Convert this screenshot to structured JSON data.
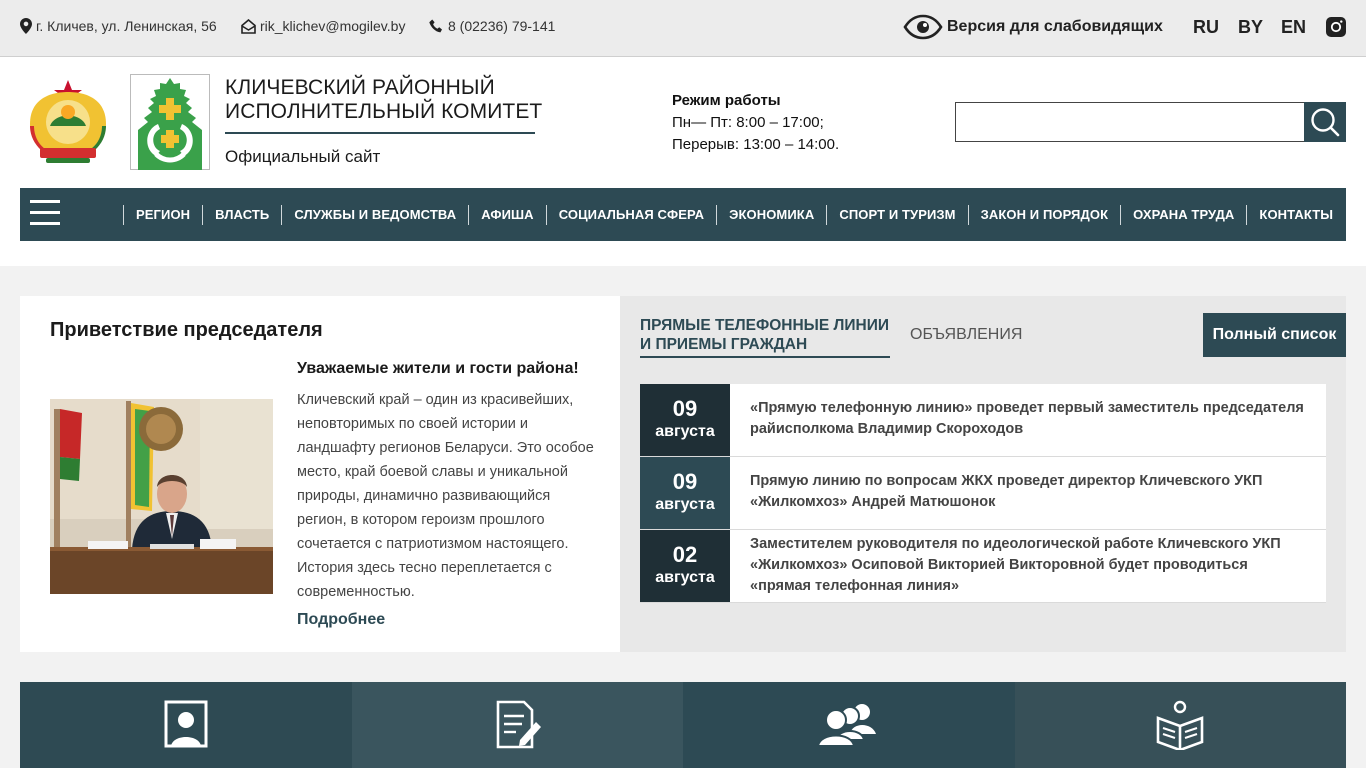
{
  "topbar": {
    "address": "г. Кличев, ул. Ленинская, 56",
    "email": "rik_klichev@mogilev.by",
    "phone": "8 (02236) 79-141",
    "accessibility": "Версия для слабовидящих",
    "languages": [
      "RU",
      "BY",
      "EN"
    ]
  },
  "header": {
    "title_line1": "Кличевский районный",
    "title_line2": "исполнительный комитет",
    "subtitle": "Официальный сайт",
    "hours_title": "Режим работы",
    "hours_line1": "Пн— Пт: 8:00 – 17:00;",
    "hours_line2": "Перерыв: 13:00 – 14:00.",
    "search_value": ""
  },
  "nav": {
    "items": [
      "Регион",
      "Власть",
      "Службы и ведомства",
      "Афиша",
      "Социальная сфера",
      "Экономика",
      "Спорт и туризм",
      "Закон и порядок",
      "Охрана труда",
      "Контакты"
    ]
  },
  "greeting": {
    "title": "Приветствие председателя",
    "heading": "Уважаемые жители и гости района!",
    "text": "Кличевский край – один из красивейших, неповторимых по своей истории и ландшафту регионов Беларуси. Это особое место, край боевой славы и уникальной природы, динамично развивающийся регион, в котором героизм прошлого сочетается с патриотизмом настоящего. История здесь тесно переплетается с современностью.",
    "more": "Подробнее"
  },
  "panel": {
    "tab_active": "Прямые телефонные линии и приемы граждан",
    "tab_other": "Объявления",
    "full_list": "Полный список",
    "news": [
      {
        "day": "09",
        "month": "августа",
        "text": "«Прямую телефонную линию» проведет первый заместитель председателя райисполкома Владимир Скороходов"
      },
      {
        "day": "09",
        "month": "августа",
        "text": "Прямую линию по вопросам ЖКХ проведет директор Кличевского УКП «Жилкомхоз» Андрей Матюшонок"
      },
      {
        "day": "02",
        "month": "августа",
        "text": "Заместителем руководителя по идеологической работе Кличевского УКП «Жилкомхоз» Осиповой Викторией Викторовной будет проводиться «прямая телефонная линия»"
      }
    ]
  },
  "colors": {
    "brand": "#2d4a54",
    "date_dark": "#1f2f36",
    "date_mid": "#2d4a54",
    "tile_1": "#2e4a53",
    "tile_2": "#3a555e",
    "tile_3": "#2d4a54",
    "tile_4": "#375058"
  },
  "icons": {
    "address": "map-pin-icon",
    "email": "home-mail-icon",
    "phone": "phone-icon",
    "accessibility": "eye-icon",
    "social": "instagram-icon",
    "search": "search-icon",
    "menu": "hamburger-icon",
    "tiles": [
      "person-portrait-icon",
      "document-edit-icon",
      "people-group-icon",
      "open-book-icon"
    ]
  }
}
